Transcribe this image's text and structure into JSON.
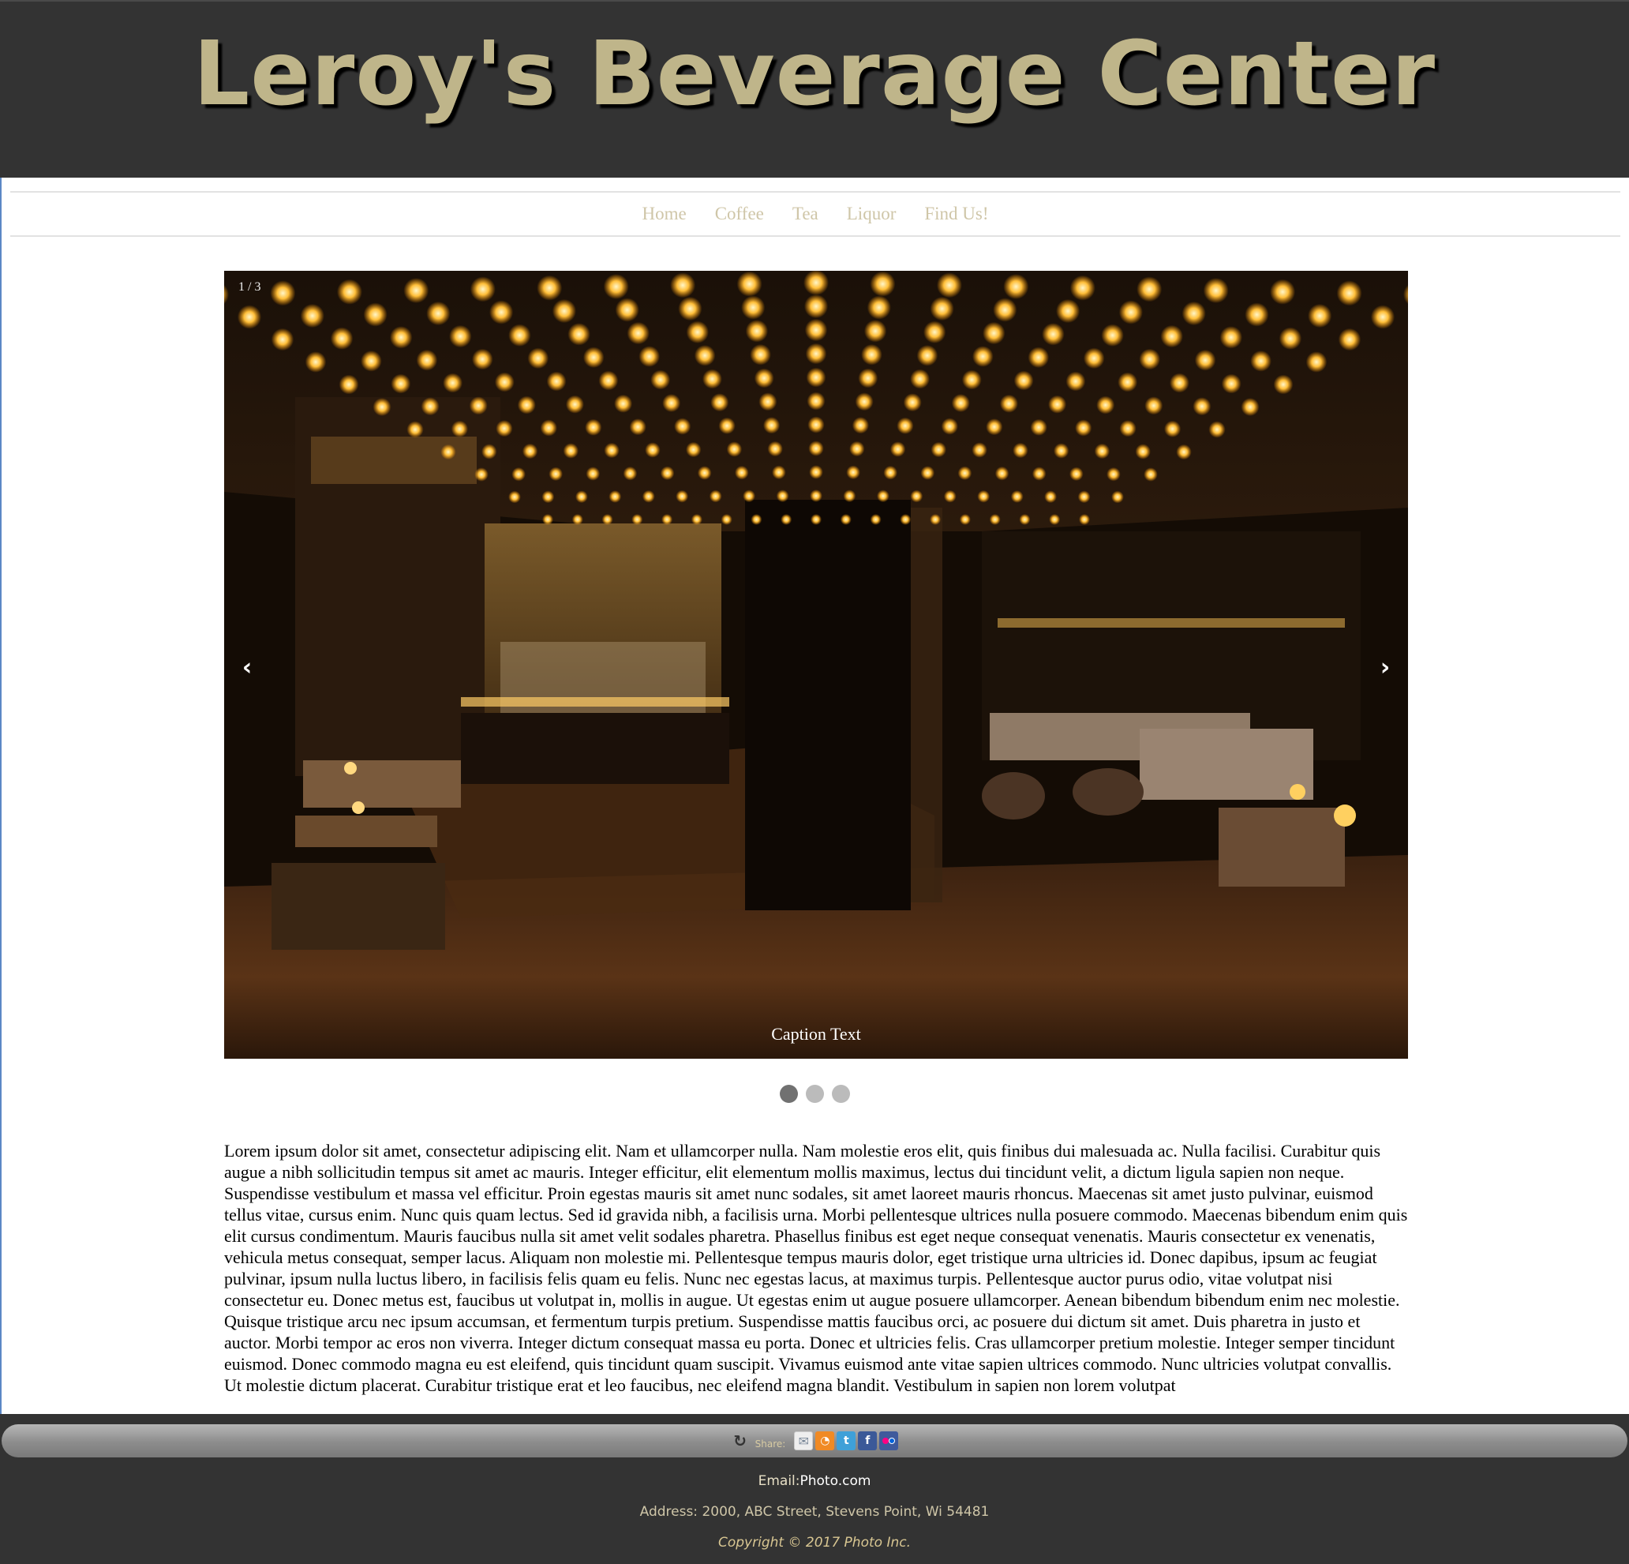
{
  "header": {
    "title": "Leroy's Beverage Center"
  },
  "nav": {
    "items": [
      {
        "label": "Home"
      },
      {
        "label": "Coffee"
      },
      {
        "label": "Tea"
      },
      {
        "label": "Liquor"
      },
      {
        "label": "Find Us!"
      }
    ]
  },
  "slideshow": {
    "counter": "1 / 3",
    "caption": "Caption Text",
    "prev_icon": "‹",
    "next_icon": "›",
    "slide_count": 3,
    "active_index": 0,
    "image_semantic": "bar-interior-with-lightbulb-ceiling"
  },
  "content": {
    "paragraph": "Lorem ipsum dolor sit amet, consectetur adipiscing elit. Nam et ullamcorper nulla. Nam molestie eros elit, quis finibus dui malesuada ac. Nulla facilisi. Curabitur quis augue a nibh sollicitudin tempus sit amet ac mauris. Integer efficitur, elit elementum mollis maximus, lectus dui tincidunt velit, a dictum ligula sapien non neque. Suspendisse vestibulum et massa vel efficitur. Proin egestas mauris sit amet nunc sodales, sit amet laoreet mauris rhoncus. Maecenas sit amet justo pulvinar, euismod tellus vitae, cursus enim. Nunc quis quam lectus. Sed id gravida nibh, a facilisis urna. Morbi pellentesque ultrices nulla posuere commodo. Maecenas bibendum enim quis elit cursus condimentum. Mauris faucibus nulla sit amet velit sodales pharetra. Phasellus finibus est eget neque consequat venenatis. Mauris consectetur ex venenatis, vehicula metus consequat, semper lacus. Aliquam non molestie mi. Pellentesque tempus mauris dolor, eget tristique urna ultricies id. Donec dapibus, ipsum ac feugiat pulvinar, ipsum nulla luctus libero, in facilisis felis quam eu felis. Nunc nec egestas lacus, at maximus turpis. Pellentesque auctor purus odio, vitae volutpat nisi consectetur eu. Donec metus est, faucibus ut volutpat in, mollis in augue. Ut egestas enim ut augue posuere ullamcorper. Aenean bibendum bibendum enim nec molestie. Quisque tristique arcu nec ipsum accumsan, et fermentum turpis pretium. Suspendisse mattis faucibus orci, ac posuere dui dictum sit amet. Duis pharetra in justo et auctor. Morbi tempor ac eros non viverra. Integer dictum consequat massa eu porta. Donec et ultricies felis. Cras ullamcorper pretium molestie. Integer semper tincidunt euismod. Donec commodo magna eu est eleifend, quis tincidunt quam suscipit. Vivamus euismod ante vitae sapien ultrices commodo. Nunc ultricies volutpat convallis. Ut molestie dictum placerat. Curabitur tristique erat et leo faucibus, nec eleifend magna blandit. Vestibulum in sapien non lorem volutpat"
  },
  "footer": {
    "share": {
      "label": "Share:",
      "icons": [
        "share-icon",
        "email-icon",
        "rss-icon",
        "twitter-icon",
        "facebook-icon",
        "flickr-icon"
      ]
    },
    "email_label": "Email:",
    "email_value": "Photo.com",
    "address": "Address: 2000, ABC Street, Stevens Point, Wi 54481",
    "copyright": "Copyright © 2017 Photo Inc."
  },
  "colors": {
    "header_bg": "#333333",
    "title_color": "#bfb58a",
    "nav_link": "#cfc6a8",
    "footer_bg": "#333333",
    "dot_active": "#717171",
    "dot_inactive": "#bbbbbb"
  }
}
